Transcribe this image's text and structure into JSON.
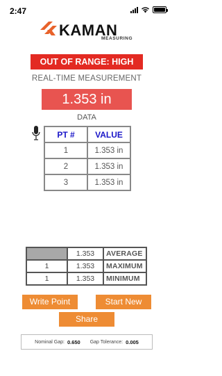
{
  "status_bar": {
    "time": "2:47"
  },
  "logo": {
    "brand": "KAMAN",
    "subtitle": "MEASURING"
  },
  "status_banner": "OUT OF RANGE: HIGH",
  "realtime_label": "REAL-TIME MEASUREMENT",
  "current_measurement": "1.353 in",
  "data_label": "DATA",
  "data_table": {
    "headers": [
      "PT #",
      "VALUE"
    ],
    "rows": [
      {
        "pt": "1",
        "value": "1.353 in"
      },
      {
        "pt": "2",
        "value": "1.353 in"
      },
      {
        "pt": "3",
        "value": "1.353 in"
      }
    ]
  },
  "stats_table": {
    "rows": [
      {
        "pt": "",
        "value": "1.353",
        "label": "AVERAGE"
      },
      {
        "pt": "1",
        "value": "1.353",
        "label": "MAXIMUM"
      },
      {
        "pt": "1",
        "value": "1.353",
        "label": "MINIMUM"
      }
    ]
  },
  "buttons": {
    "write_point": "Write Point",
    "start_new": "Start New",
    "share": "Share"
  },
  "gap_info": {
    "nominal_label": "Nominal Gap:",
    "nominal_value": "0.650",
    "tolerance_label": "Gap Tolerance:",
    "tolerance_value": "0.005"
  },
  "colors": {
    "banner_red": "#e32a22",
    "measurement_red": "#e85450",
    "button_orange": "#ee8c34",
    "header_blue": "#1a16c8",
    "logo_orange": "#e8622a"
  },
  "icons": [
    "signal-icon",
    "wifi-icon",
    "battery-icon",
    "microphone-icon",
    "kaman-logo-mark"
  ]
}
